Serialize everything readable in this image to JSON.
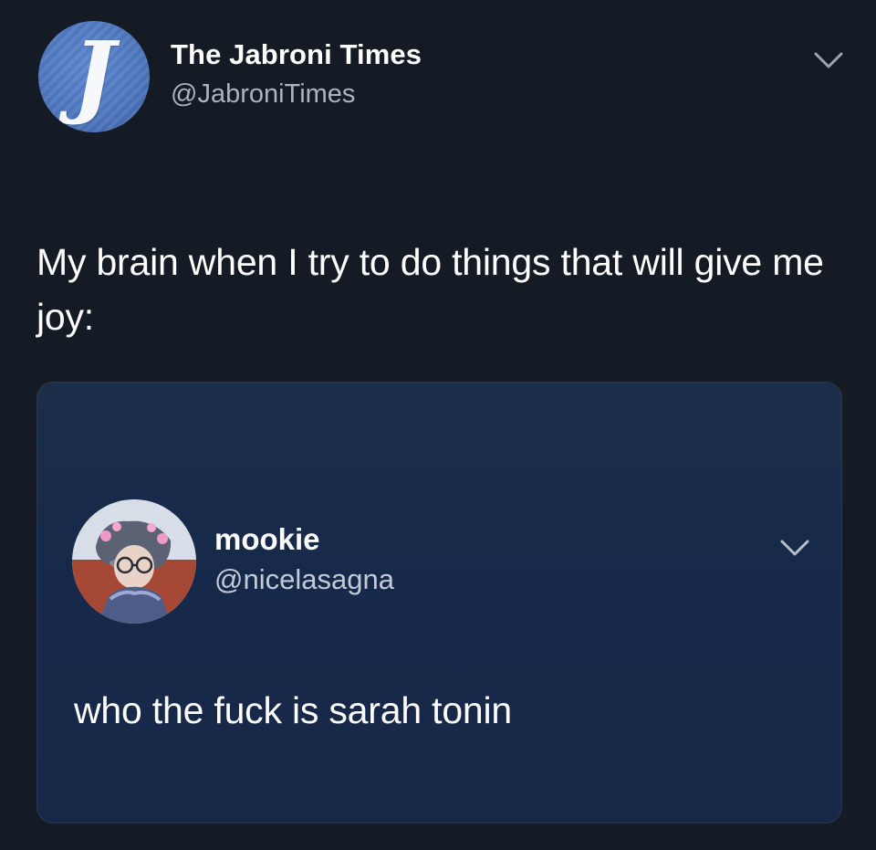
{
  "tweet": {
    "author": {
      "avatar_letter": "J",
      "name": "The Jabroni Times",
      "handle": "@JabroniTimes",
      "avatar_color": "#4f77be"
    },
    "text": "My brain when I try to do things that will give me joy:",
    "menu_icon": "chevron-down-icon"
  },
  "media": {
    "quoted_tweet": {
      "author": {
        "name": "mookie",
        "handle": "@nicelasagna"
      },
      "text": "who the fuck is sarah tonin",
      "menu_icon": "chevron-down-icon"
    },
    "background_color": "#172748"
  },
  "colors": {
    "background": "#151b24",
    "handle_text": "#aab4bf",
    "icon": "#9ba6b3"
  }
}
